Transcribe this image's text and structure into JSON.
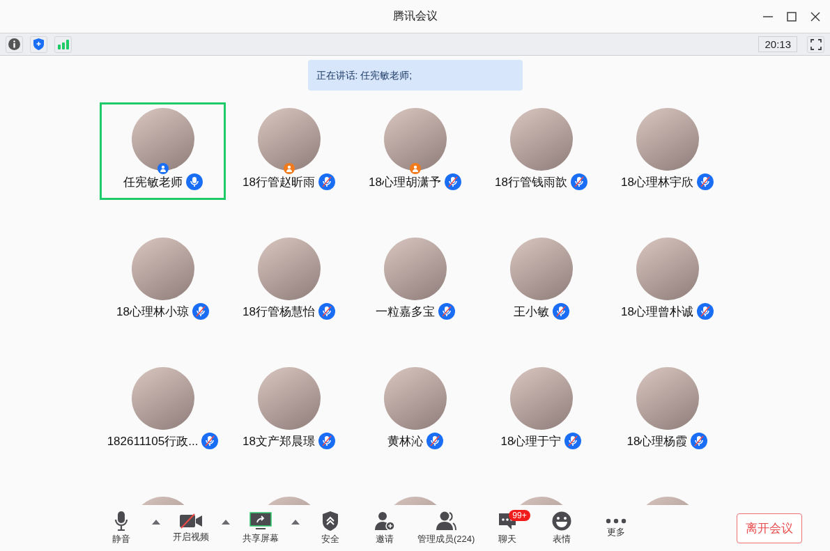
{
  "window": {
    "title": "腾讯会议"
  },
  "toolbar": {
    "time": "20:13"
  },
  "speaking": "正在讲话: 任宪敏老师;",
  "participants": [
    {
      "name": "任宪敏老师",
      "badge": true,
      "color": "#1a6ef5",
      "muted": false,
      "selected": true
    },
    {
      "name": "18行管赵昕雨",
      "badge": true,
      "color": "#f07a1c",
      "muted": true,
      "selected": false
    },
    {
      "name": "18心理胡潇予",
      "badge": true,
      "color": "#f07a1c",
      "muted": true,
      "selected": false
    },
    {
      "name": "18行管钱雨歆",
      "badge": false,
      "muted": true,
      "selected": false
    },
    {
      "name": "18心理林宇欣",
      "badge": false,
      "muted": true,
      "selected": false
    },
    {
      "name": "18心理林小琼",
      "badge": false,
      "muted": true,
      "selected": false
    },
    {
      "name": "18行管杨慧怡",
      "badge": false,
      "muted": true,
      "selected": false
    },
    {
      "name": "一粒嘉多宝",
      "badge": false,
      "muted": true,
      "selected": false
    },
    {
      "name": "王小敏",
      "badge": false,
      "muted": true,
      "selected": false
    },
    {
      "name": "18心理曾朴诚",
      "badge": false,
      "muted": true,
      "selected": false
    },
    {
      "name": "182611105行政...",
      "badge": false,
      "muted": true,
      "selected": false
    },
    {
      "name": "18文产郑晨璟",
      "badge": false,
      "muted": true,
      "selected": false
    },
    {
      "name": "黄林沁",
      "badge": false,
      "muted": true,
      "selected": false
    },
    {
      "name": "18心理于宁",
      "badge": false,
      "muted": true,
      "selected": false
    },
    {
      "name": "18心理杨霞",
      "badge": false,
      "muted": true,
      "selected": false
    },
    {
      "selected": false
    },
    {
      "selected": false
    },
    {
      "selected": false
    },
    {
      "selected": false
    },
    {
      "selected": false
    }
  ],
  "controls": [
    {
      "kind": "mic",
      "label": "静音",
      "menu": true
    },
    {
      "kind": "video",
      "label": "开启视频",
      "on": false,
      "menu": true
    },
    {
      "kind": "share",
      "label": "共享屏幕",
      "menu": true
    },
    {
      "kind": "security",
      "label": "安全",
      "menu": false
    },
    {
      "kind": "invite",
      "label": "邀请",
      "menu": false
    },
    {
      "kind": "members",
      "label": "管理成员(224)",
      "menu": false
    },
    {
      "kind": "chat",
      "label": "聊天",
      "badge": "99+",
      "menu": false
    },
    {
      "kind": "emoji",
      "label": "表情",
      "menu": false
    },
    {
      "kind": "more",
      "label": "更多",
      "menu": false
    }
  ],
  "leave_button": "离开会议"
}
